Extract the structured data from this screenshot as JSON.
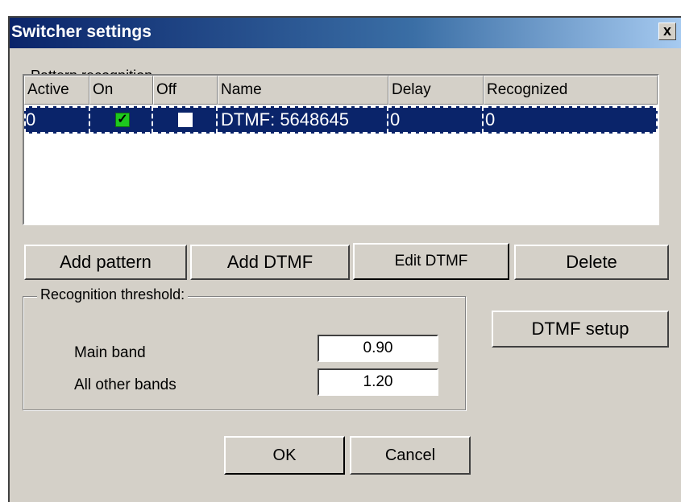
{
  "window": {
    "title": "Switcher settings",
    "close_glyph": "x"
  },
  "pattern_group": {
    "label": "Pattern recognition"
  },
  "table": {
    "columns": [
      "Active",
      "On",
      "Off",
      "Name",
      "Delay",
      "Recognized"
    ],
    "rows": [
      {
        "active": "0",
        "on": true,
        "off": false,
        "name": "DTMF: 5648645",
        "delay": "0",
        "recognized": "0"
      }
    ]
  },
  "buttons": {
    "add_pattern": "Add pattern",
    "add_dtmf": "Add DTMF",
    "edit_dtmf": "Edit DTMF",
    "delete": "Delete",
    "dtmf_setup": "DTMF setup",
    "ok": "OK",
    "cancel": "Cancel"
  },
  "threshold": {
    "title": "Recognition threshold:",
    "main_band_label": "Main band",
    "main_band_value": "0.90",
    "other_bands_label": "All other bands",
    "other_bands_value": "1.20"
  },
  "colors": {
    "selection": "#0a246a",
    "checked": "#1ec81e",
    "dialog": "#d4d0c8"
  }
}
